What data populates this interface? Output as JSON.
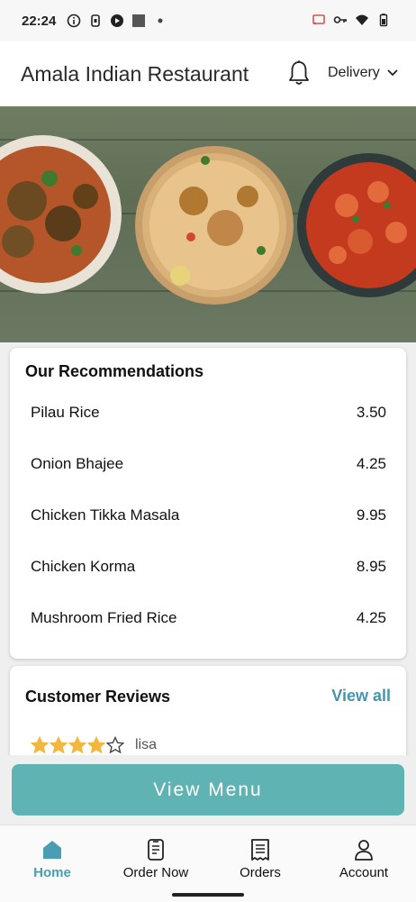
{
  "status_bar": {
    "time": "22:24",
    "left_icons": [
      "info-circle-icon",
      "sim-icon",
      "app-icon",
      "square-icon",
      "dot-icon"
    ],
    "right_icons": [
      "cast-icon",
      "key-icon",
      "wifi-icon",
      "battery-icon"
    ]
  },
  "header": {
    "title": "Amala Indian Restaurant",
    "notification_icon": "bell-icon",
    "order_type": "Delivery",
    "order_type_icon": "chevron-down-icon"
  },
  "hero": {
    "image": "food-banner-image"
  },
  "recommendations": {
    "title": "Our Recommendations",
    "items": [
      {
        "name": "Pilau Rice",
        "price": "3.50"
      },
      {
        "name": "Onion Bhajee",
        "price": "4.25"
      },
      {
        "name": "Chicken Tikka Masala",
        "price": "9.95"
      },
      {
        "name": "Chicken Korma",
        "price": "8.95"
      },
      {
        "name": "Mushroom Fried Rice",
        "price": "4.25"
      }
    ]
  },
  "reviews": {
    "title": "Customer Reviews",
    "view_all_label": "View all",
    "items": [
      {
        "rating": 4,
        "max_rating": 5,
        "author": "lisa"
      }
    ]
  },
  "view_menu_label": "View Menu",
  "bottom_nav": {
    "active": "Home",
    "items": [
      {
        "label": "Home",
        "icon": "home-icon"
      },
      {
        "label": "Order Now",
        "icon": "phone-menu-icon"
      },
      {
        "label": "Orders",
        "icon": "receipt-icon"
      },
      {
        "label": "Account",
        "icon": "user-icon"
      }
    ]
  },
  "colors": {
    "accent": "#5fb3b3",
    "link": "#4496ad",
    "nav_active": "#4a9eb3",
    "star": "#f3b63f"
  }
}
